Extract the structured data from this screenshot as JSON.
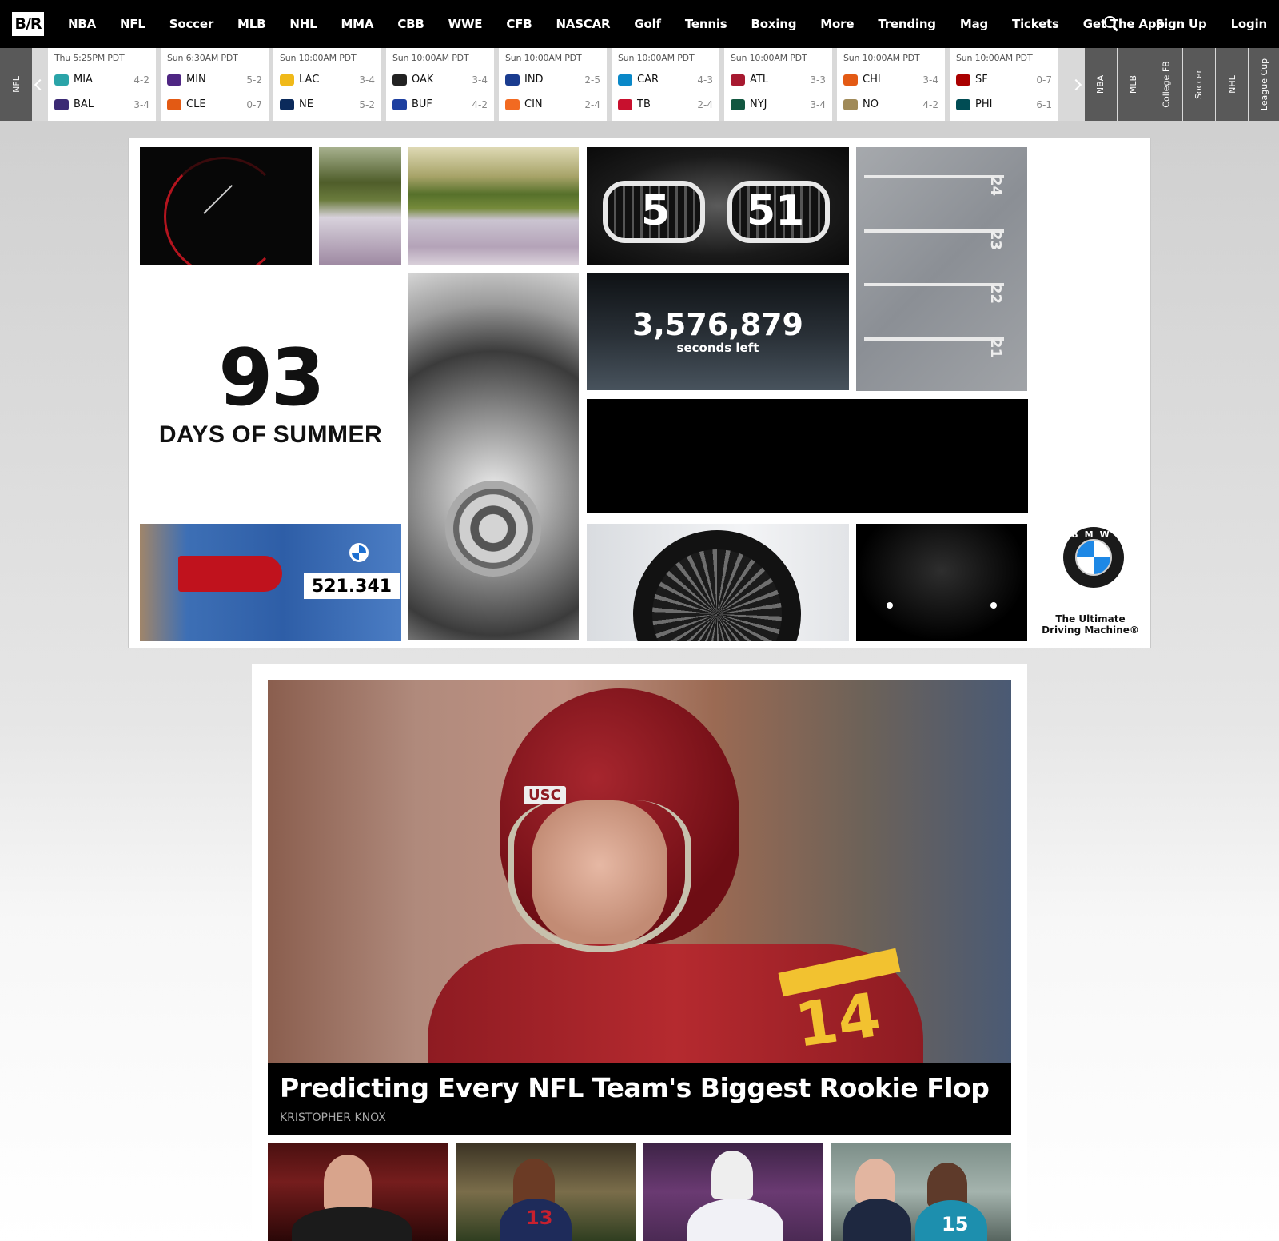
{
  "logo": "B/R",
  "nav": {
    "items": [
      "NBA",
      "NFL",
      "Soccer",
      "MLB",
      "NHL",
      "MMA",
      "CBB",
      "WWE",
      "CFB",
      "NASCAR",
      "Golf",
      "Tennis",
      "Boxing",
      "More",
      "Trending",
      "Mag",
      "Tickets",
      "Get The App"
    ],
    "sign_up": "Sign Up",
    "login": "Login",
    "search_icon": "search-icon"
  },
  "scores": {
    "active_sport": "NFL",
    "games": [
      {
        "time": "Thu 5:25PM PDT",
        "away": {
          "abbr": "MIA",
          "rec": "4-2",
          "color": "#2aa4a8"
        },
        "home": {
          "abbr": "BAL",
          "rec": "3-4",
          "color": "#3b2a74"
        }
      },
      {
        "time": "Sun 6:30AM PDT",
        "away": {
          "abbr": "MIN",
          "rec": "5-2",
          "color": "#4f2683"
        },
        "home": {
          "abbr": "CLE",
          "rec": "0-7",
          "color": "#e35a14"
        }
      },
      {
        "time": "Sun 10:00AM PDT",
        "away": {
          "abbr": "LAC",
          "rec": "3-4",
          "color": "#f0b919"
        },
        "home": {
          "abbr": "NE",
          "rec": "5-2",
          "color": "#0b2a5b"
        }
      },
      {
        "time": "Sun 10:00AM PDT",
        "away": {
          "abbr": "OAK",
          "rec": "3-4",
          "color": "#222222"
        },
        "home": {
          "abbr": "BUF",
          "rec": "4-2",
          "color": "#1d3fa0"
        }
      },
      {
        "time": "Sun 10:00AM PDT",
        "away": {
          "abbr": "IND",
          "rec": "2-5",
          "color": "#1a3c8f"
        },
        "home": {
          "abbr": "CIN",
          "rec": "2-4",
          "color": "#f26a21"
        }
      },
      {
        "time": "Sun 10:00AM PDT",
        "away": {
          "abbr": "CAR",
          "rec": "4-3",
          "color": "#0a88c8"
        },
        "home": {
          "abbr": "TB",
          "rec": "2-4",
          "color": "#c8102e"
        }
      },
      {
        "time": "Sun 10:00AM PDT",
        "away": {
          "abbr": "ATL",
          "rec": "3-3",
          "color": "#a71930"
        },
        "home": {
          "abbr": "NYJ",
          "rec": "3-4",
          "color": "#125740"
        }
      },
      {
        "time": "Sun 10:00AM PDT",
        "away": {
          "abbr": "CHI",
          "rec": "3-4",
          "color": "#e35a14"
        },
        "home": {
          "abbr": "NO",
          "rec": "4-2",
          "color": "#a08a58"
        }
      },
      {
        "time": "Sun 10:00AM PDT",
        "away": {
          "abbr": "SF",
          "rec": "0-7",
          "color": "#aa0000"
        },
        "home": {
          "abbr": "PHI",
          "rec": "6-1",
          "color": "#004c54"
        }
      }
    ],
    "other_sports": [
      "NBA",
      "MLB",
      "College FB",
      "Soccer",
      "NHL",
      "League Cup"
    ]
  },
  "ad": {
    "days_number": "93",
    "days_label": "DAYS OF SUMMER",
    "counter_number": "3,576,879",
    "counter_label": "seconds left",
    "grille_numbers": [
      "5",
      "51"
    ],
    "parking_numbers": [
      "24",
      "23",
      "22",
      "21"
    ],
    "plate_number": "521.341",
    "brand_letters": "BMW",
    "tagline_line1": "The Ultimate",
    "tagline_line2": "Driving Machine®"
  },
  "feed": {
    "hero": {
      "title": "Predicting Every NFL Team's Biggest Rookie Flop",
      "author": "KRISTOPHER KNOX",
      "helmet_label": "USC",
      "jersey_number": "14"
    },
    "thumbs": [
      {
        "kind": "coach"
      },
      {
        "kind": "arizona-player",
        "number": "13"
      },
      {
        "kind": "blue-jays-player"
      },
      {
        "kind": "hornets-player",
        "number": "15"
      }
    ]
  }
}
